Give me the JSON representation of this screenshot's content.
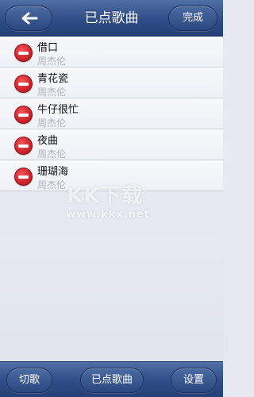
{
  "header": {
    "title": "已点歌曲",
    "done_label": "完成"
  },
  "songs": [
    {
      "title": "借口",
      "artist": "周杰伦"
    },
    {
      "title": "青花瓷",
      "artist": "周杰伦"
    },
    {
      "title": "牛仔很忙",
      "artist": "周杰伦"
    },
    {
      "title": "夜曲",
      "artist": "周杰伦"
    },
    {
      "title": "珊瑚海",
      "artist": "周杰伦"
    }
  ],
  "watermark": {
    "logo": "KK下载",
    "url": "www.kkx.net"
  },
  "footer": {
    "cut_label": "切歌",
    "played_label": "已点歌曲",
    "settings_label": "设置"
  },
  "icons": {
    "back": "arrow-left-icon",
    "delete": "minus-circle-icon"
  }
}
